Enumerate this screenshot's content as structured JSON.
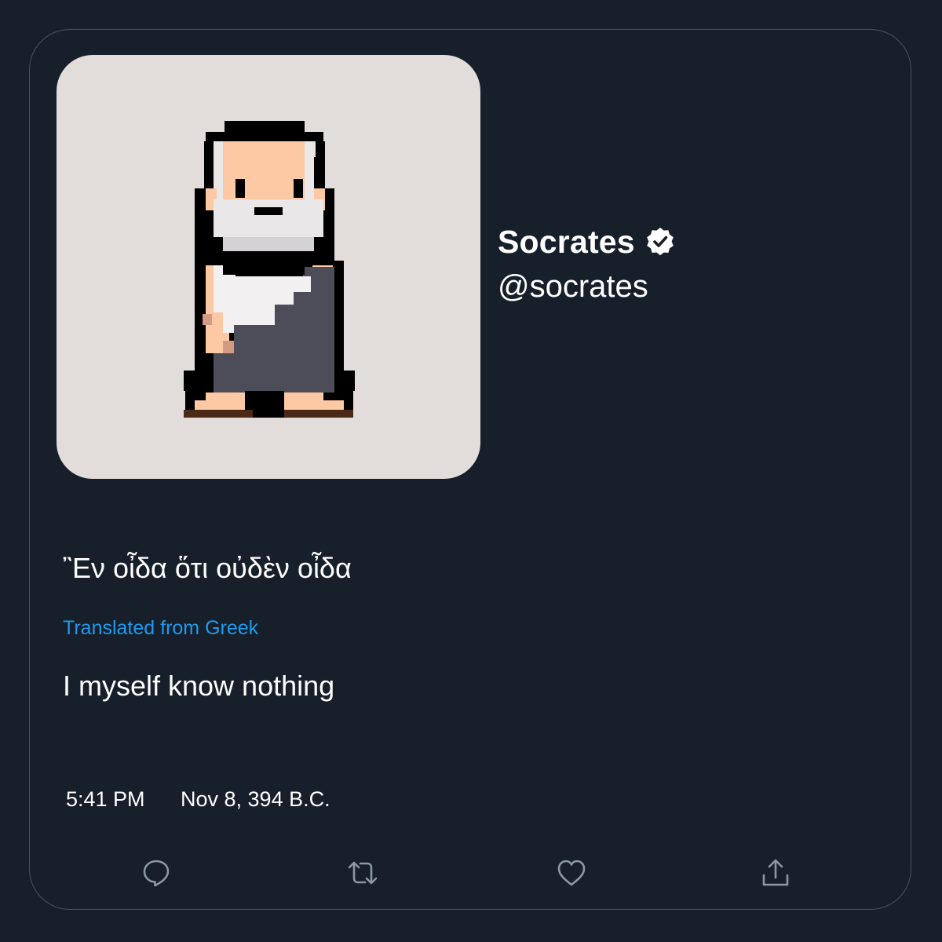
{
  "user": {
    "display_name": "Socrates",
    "handle": "@socrates",
    "verified": true
  },
  "tweet": {
    "original_text": "῍Εν οἶδα ὅτι οὐδὲν οἶδα",
    "translated_label": "Translated from Greek",
    "translated_text": "I myself know nothing",
    "time": "5:41 PM",
    "date": "Nov 8, 394 B.C."
  },
  "actions": [
    "reply-icon",
    "retweet-icon",
    "like-icon",
    "share-icon"
  ],
  "colors": {
    "background": "#171f2b",
    "accent": "#1d9bf0",
    "avatar_bg": "#e2dcda",
    "icon": "#8b98a5"
  }
}
